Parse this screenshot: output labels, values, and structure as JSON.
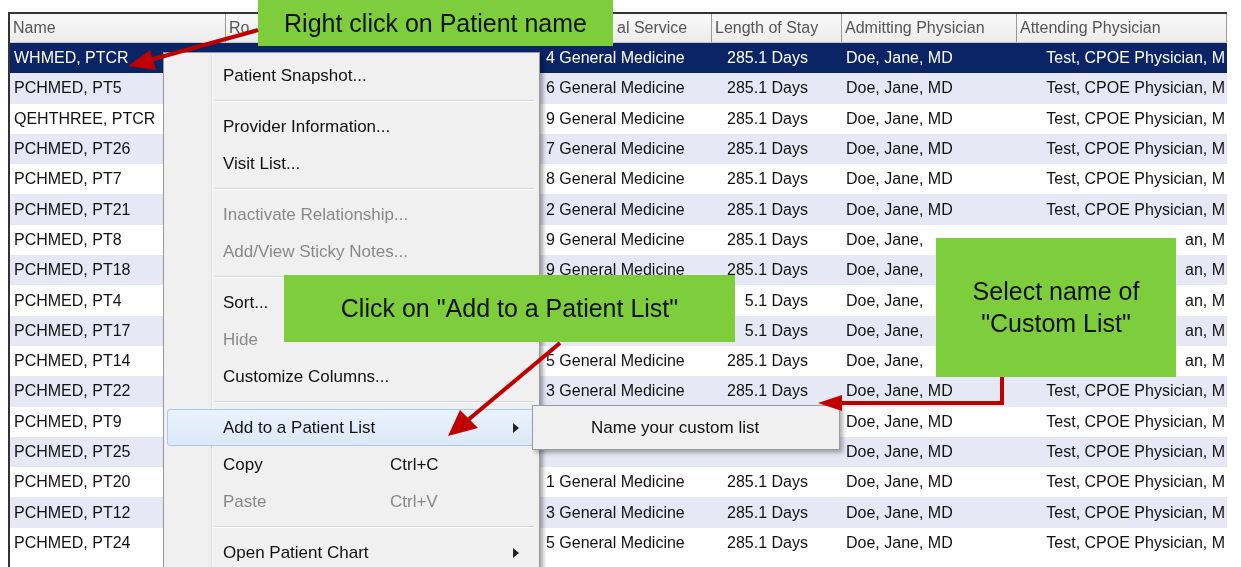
{
  "table": {
    "columns": [
      "Name",
      "Ro",
      "al Service",
      "Length of Stay",
      "Admitting Physician",
      "Attending Physician"
    ],
    "rows": [
      {
        "name": "WHMED, PTCR",
        "service": "4 General Medicine",
        "stay": "285.1 Days",
        "admitting": "Doe, Jane, MD",
        "attending": "Test, CPOE Physician, M",
        "selected": true
      },
      {
        "name": "PCHMED, PT5",
        "service": "6 General Medicine",
        "stay": "285.1 Days",
        "admitting": "Doe, Jane, MD",
        "attending": "Test, CPOE Physician, M",
        "selected": false
      },
      {
        "name": "QEHTHREE, PTCR",
        "service": "9 General Medicine",
        "stay": "285.1 Days",
        "admitting": "Doe, Jane, MD",
        "attending": "Test, CPOE Physician, M",
        "selected": false
      },
      {
        "name": "PCHMED, PT26",
        "service": "7 General Medicine",
        "stay": "285.1 Days",
        "admitting": "Doe, Jane, MD",
        "attending": "Test, CPOE Physician, M",
        "selected": false
      },
      {
        "name": "PCHMED, PT7",
        "service": "8 General Medicine",
        "stay": "285.1 Days",
        "admitting": "Doe, Jane, MD",
        "attending": "Test, CPOE Physician, M",
        "selected": false
      },
      {
        "name": "PCHMED, PT21",
        "service": "2 General Medicine",
        "stay": "285.1 Days",
        "admitting": "Doe, Jane, MD",
        "attending": "Test, CPOE Physician, M",
        "selected": false
      },
      {
        "name": "PCHMED, PT8",
        "service": "9 General Medicine",
        "stay": "285.1 Days",
        "admitting": "Doe, Jane,",
        "attending": "an, M",
        "selected": false
      },
      {
        "name": "PCHMED, PT18",
        "service": "9 General Medicine",
        "stay": "285.1 Days",
        "admitting": "Doe, Jane,",
        "attending": "an, M",
        "selected": false
      },
      {
        "name": "PCHMED, PT4",
        "service": "",
        "stay": "5.1 Days",
        "admitting": "Doe, Jane,",
        "attending": "an, M",
        "selected": false
      },
      {
        "name": "PCHMED, PT17",
        "service": "",
        "stay": "5.1 Days",
        "admitting": "Doe, Jane,",
        "attending": "an, M",
        "selected": false
      },
      {
        "name": "PCHMED, PT14",
        "service": "5 General Medicine",
        "stay": "285.1 Days",
        "admitting": "Doe, Jane,",
        "attending": "an, M",
        "selected": false
      },
      {
        "name": "PCHMED, PT22",
        "service": "3 General Medicine",
        "stay": "285.1 Days",
        "admitting": "Doe, Jane, MD",
        "attending": "Test, CPOE Physician, M",
        "selected": false
      },
      {
        "name": "PCHMED, PT9",
        "service": "",
        "stay": "",
        "admitting": "Doe, Jane, MD",
        "attending": "Test, CPOE Physician, M",
        "selected": false
      },
      {
        "name": "PCHMED, PT25",
        "service": "",
        "stay": "",
        "admitting": "Doe, Jane, MD",
        "attending": "Test, CPOE Physician, M",
        "selected": false
      },
      {
        "name": "PCHMED, PT20",
        "service": "1 General Medicine",
        "stay": "285.1 Days",
        "admitting": "Doe, Jane, MD",
        "attending": "Test, CPOE Physician, M",
        "selected": false
      },
      {
        "name": "PCHMED, PT12",
        "service": "3 General Medicine",
        "stay": "285.1 Days",
        "admitting": "Doe, Jane, MD",
        "attending": "Test, CPOE Physician, M",
        "selected": false
      },
      {
        "name": "PCHMED, PT24",
        "service": "5 General Medicine",
        "stay": "285.1 Days",
        "admitting": "Doe, Jane, MD",
        "attending": "Test, CPOE Physician, M",
        "selected": false
      }
    ]
  },
  "context_menu": {
    "items": [
      {
        "kind": "item",
        "label": "Patient Snapshot...",
        "disabled": false,
        "selected": false
      },
      {
        "kind": "separator"
      },
      {
        "kind": "item",
        "label": "Provider Information...",
        "disabled": false,
        "selected": false
      },
      {
        "kind": "item",
        "label": "Visit List...",
        "disabled": false,
        "selected": false
      },
      {
        "kind": "separator"
      },
      {
        "kind": "item",
        "label": "Inactivate Relationship...",
        "disabled": true,
        "selected": false
      },
      {
        "kind": "item",
        "label": "Add/View Sticky Notes...",
        "disabled": true,
        "selected": false
      },
      {
        "kind": "separator"
      },
      {
        "kind": "item",
        "label": "Sort...",
        "disabled": false,
        "selected": false
      },
      {
        "kind": "item",
        "label": "Hide",
        "disabled": true,
        "selected": false
      },
      {
        "kind": "item",
        "label": "Customize Columns...",
        "disabled": false,
        "selected": false
      },
      {
        "kind": "separator"
      },
      {
        "kind": "submenu",
        "label": "Add to a Patient List",
        "disabled": false,
        "selected": true
      },
      {
        "kind": "item",
        "label": "Copy",
        "shortcut": "Ctrl+C",
        "disabled": false,
        "selected": false
      },
      {
        "kind": "item",
        "label": "Paste",
        "shortcut": "Ctrl+V",
        "disabled": true,
        "selected": false
      },
      {
        "kind": "separator"
      },
      {
        "kind": "submenu",
        "label": "Open Patient Chart",
        "disabled": false,
        "selected": false
      }
    ]
  },
  "submenu": {
    "items": [
      {
        "label": "Name your custom list"
      }
    ]
  },
  "callouts": [
    {
      "text": "Right click on Patient name"
    },
    {
      "text": "Click on \"Add to a Patient List\""
    },
    {
      "text": "Select name of \"Custom List\""
    }
  ]
}
